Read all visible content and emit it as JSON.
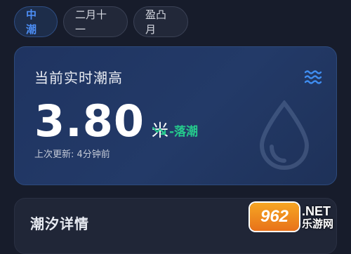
{
  "tabs": [
    {
      "label": "中潮",
      "active": true
    },
    {
      "label": "二月十一",
      "active": false
    },
    {
      "label": "盈凸月",
      "active": false
    }
  ],
  "tide_card": {
    "title": "当前实时潮高",
    "value": "3.80",
    "unit": "米",
    "trend": "-落潮",
    "updated": "上次更新: 4分钟前",
    "icon": "waves-icon",
    "background_icon": "water-drop-icon"
  },
  "details": {
    "title": "潮汐详情"
  },
  "watermark": {
    "logo": "962",
    "suffix": ".NET",
    "site": "乐游网"
  },
  "colors": {
    "accent_blue": "#4d8ef5",
    "trend_green": "#25c98c",
    "background": "#171c2b"
  }
}
